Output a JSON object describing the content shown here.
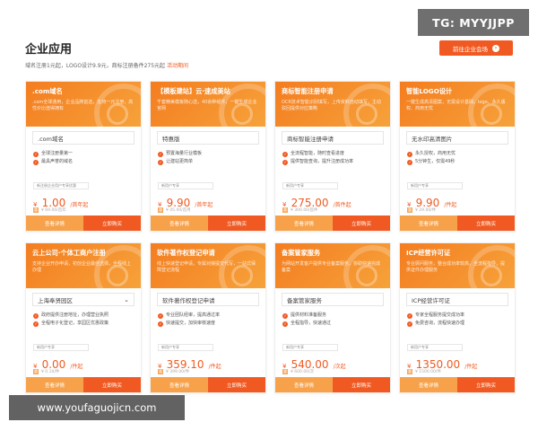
{
  "watermark_top": "TG: MYYJJPP",
  "watermark_bottom": "www.youfaguojicn.com",
  "header": {
    "title": "企业应用",
    "subtitle": "域名注册1元起，LOGO设计9.9元，商标注册备件275元起",
    "subtitle_highlight": "活动期间",
    "cta_label": "前往企业会场",
    "cta_icon": "›"
  },
  "colors": {
    "accent": "#f05a22",
    "light_accent": "#f7a24b"
  },
  "cards": [
    {
      "title": ".com域名",
      "desc": ".com全球通用，企业品牌首选，支持一元注册，高性价比值得拥有",
      "select": ".com域名",
      "has_chevron": false,
      "features": [
        "全球注册量第一",
        "最具声誉的域名"
      ],
      "promo": "新注册企业用户专享优惠",
      "currency": "¥",
      "price": "1.00",
      "unit": "/首年起",
      "orig": "¥ 69.00/首年",
      "tag": "惠",
      "btn_a": "查看详情",
      "btn_b": "立即购买"
    },
    {
      "title": "【模板建站】云·速成美站",
      "desc": "千套精美模板随心选，40余种组件，一键生成企业官网",
      "select": "特惠版",
      "has_chevron": false,
      "features": [
        "预置海量行业模板",
        "让建站更简单"
      ],
      "promo": "新用户专享",
      "currency": "¥",
      "price": "9.90",
      "unit": "/首年起",
      "orig": "¥ 45.00/首月",
      "tag": "惠",
      "btn_a": "查看详情",
      "btn_b": "立即购买"
    },
    {
      "title": "商标智能注册申请",
      "desc": "OCR技术智能识别填写，上传资料自动填写，主动驳回提供对应策略",
      "select": "商标智能注册申请",
      "has_chevron": false,
      "features": [
        "全流程智能，随时查看进度",
        "提供智能查询，提升注册成功率"
      ],
      "promo": "新用户专享",
      "currency": "¥",
      "price": "275.00",
      "unit": "/首件起",
      "orig": "¥ 300.00/首件",
      "tag": "惠",
      "btn_a": "查看详情",
      "btn_b": "立即购买"
    },
    {
      "title": "智能LOGO设计",
      "desc": "一键生成高清图案，无需设计基础，logo、永久版权、商用无忧",
      "select": "无水印高清图片",
      "has_chevron": false,
      "features": [
        "永久授权，商用无忧",
        "5分钟生，仅需49秒"
      ],
      "promo": "新用户专享",
      "currency": "¥",
      "price": "9.90",
      "unit": "/件起",
      "orig": "¥ 29.00/件",
      "tag": "惠",
      "btn_a": "查看详情",
      "btn_b": "立即购买"
    },
    {
      "title": "云上公司·个体工商户注册",
      "desc": "支持企业开办申请，初创企业最佳选择，全程线上办理",
      "select": "上海奉贤园区",
      "has_chevron": true,
      "features": [
        "政府提供注册地址，办理营业执照",
        "全程电子化登记，享园区优惠政策"
      ],
      "promo": "新用户专享",
      "currency": "¥",
      "price": "0.00",
      "unit": "/件起",
      "orig": "¥ 0.10/件",
      "tag": "惠",
      "btn_a": "查看详情",
      "btn_b": "立即购买"
    },
    {
      "title": "软件著作权登记申请",
      "desc": "线上快速登记申请，专属对接提交代写，一站式保障登记流程",
      "select": "软件著作权登记申请",
      "has_chevron": false,
      "features": [
        "专业团队经审，提高通过率",
        "快速提交，加快审核速度"
      ],
      "promo": "新用户专享",
      "currency": "¥",
      "price": "359.10",
      "unit": "/件起",
      "orig": "¥ 399.00/件",
      "tag": "惠",
      "btn_a": "查看详情",
      "btn_b": "立即购买"
    },
    {
      "title": "备案管家服务",
      "desc": "为网站开发客户提供专业备案服务，协助快速完成备案",
      "select": "备案管家服务",
      "has_chevron": false,
      "features": [
        "提供材料准备服务",
        "全程指导，快速通过"
      ],
      "promo": "新用户专享",
      "currency": "¥",
      "price": "540.00",
      "unit": "/次起",
      "orig": "¥ 600.00/次",
      "tag": "惠",
      "btn_a": "查看详情",
      "btn_b": "立即购买"
    },
    {
      "title": "ICP经营许可证",
      "desc": "专业顾问服务，整合成功率较高，全流程指导，提供证件办理服务",
      "select": "ICP经营许可证",
      "has_chevron": false,
      "features": [
        "专家全程服务提交成功率",
        "免费咨询，流程快速办理"
      ],
      "promo": "新用户专享",
      "currency": "¥",
      "price": "1350.00",
      "unit": "/件起",
      "orig": "¥ 1500.00/件",
      "tag": "惠",
      "btn_a": "查看详情",
      "btn_b": "立即购买"
    }
  ]
}
